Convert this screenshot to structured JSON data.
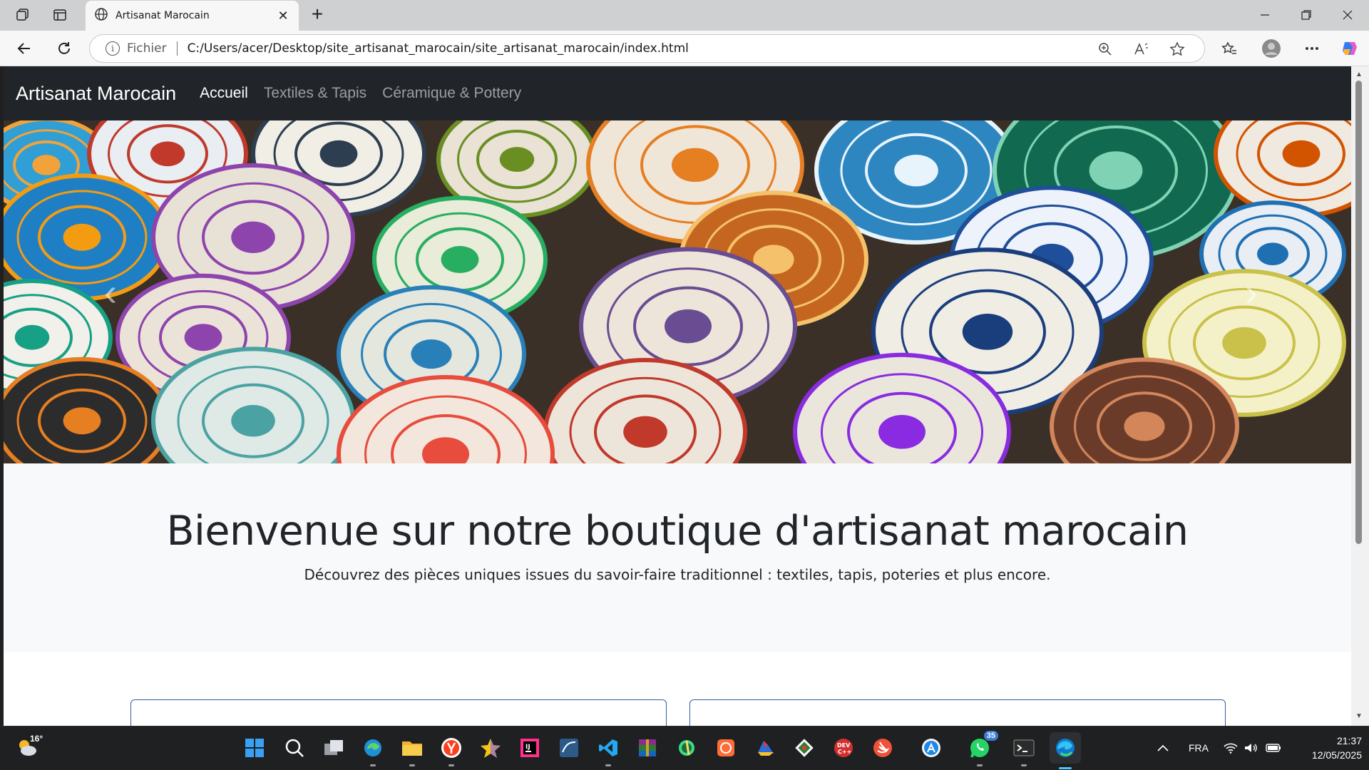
{
  "browser": {
    "tab_title": "Artisanat Marocain",
    "address_scheme": "Fichier",
    "address_url": "C:/Users/acer/Desktop/site_artisanat_marocain/site_artisanat_marocain/index.html"
  },
  "site": {
    "brand": "Artisanat Marocain",
    "nav": [
      {
        "label": "Accueil",
        "active": true
      },
      {
        "label": "Textiles & Tapis",
        "active": false
      },
      {
        "label": "Céramique & Pottery",
        "active": false
      }
    ],
    "carousel": {
      "prev_glyph": "‹",
      "next_glyph": "›"
    },
    "welcome": {
      "title": "Bienvenue sur notre boutique d'artisanat marocain",
      "subtitle": "Découvrez des pièces uniques issues du savoir-faire traditionnel : textiles, tapis, poteries et plus encore."
    }
  },
  "taskbar": {
    "weather_temp": "16°",
    "apps": [
      "start-icon",
      "search-icon",
      "task-view-icon",
      "edge-beta-icon",
      "file-explorer-icon",
      "yandex-icon",
      "star-app-icon",
      "intellij-icon",
      "mysql-workbench-icon",
      "vscode-icon",
      "winrar-icon",
      "android-studio-icon",
      "postman-icon",
      "cloud-app-icon",
      "git-icon",
      "devcpp-icon",
      "swift-icon",
      "app-store-icon",
      "whatsapp-icon",
      "terminal-icon",
      "edge-icon"
    ],
    "whatsapp_badge": "35",
    "language": "FRA",
    "time": "21:37",
    "date": "12/05/2025"
  }
}
